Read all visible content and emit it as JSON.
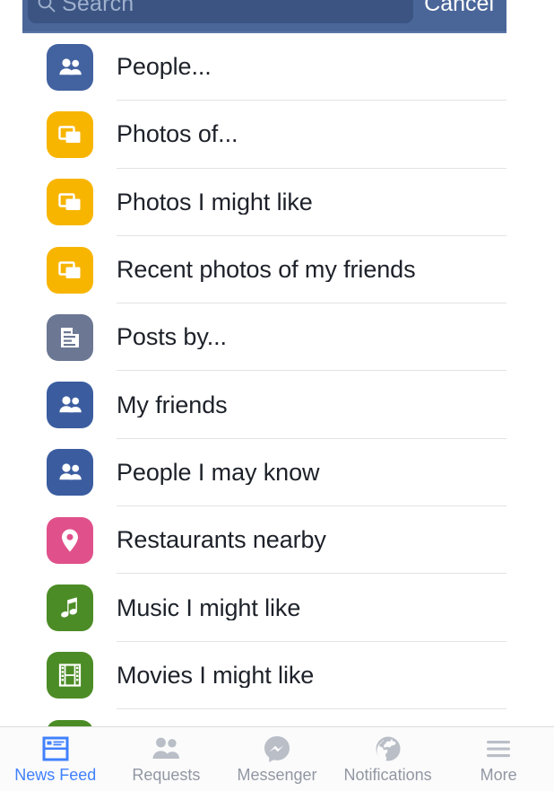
{
  "search": {
    "placeholder": "Search",
    "value": "",
    "icon": "search-icon",
    "cancel_label": "Cancel",
    "header_color": "#4a6699",
    "field_color": "#3b5482"
  },
  "results": {
    "items": [
      {
        "label": "People...",
        "icon": "people-icon",
        "color": "#4262a0"
      },
      {
        "label": "Photos of...",
        "icon": "photos-icon",
        "color": "#f7b500"
      },
      {
        "label": "Photos I might like",
        "icon": "photos-icon",
        "color": "#f7b500"
      },
      {
        "label": "Recent photos of my friends",
        "icon": "photos-icon",
        "color": "#f7b500"
      },
      {
        "label": "Posts by...",
        "icon": "post-icon",
        "color": "#6b7793"
      },
      {
        "label": "My friends",
        "icon": "people-icon",
        "color": "#3b5da0"
      },
      {
        "label": "People I may know",
        "icon": "people-icon",
        "color": "#3b5da0"
      },
      {
        "label": "Restaurants nearby",
        "icon": "location-pin-icon",
        "color": "#e0518b"
      },
      {
        "label": "Music I might like",
        "icon": "music-note-icon",
        "color": "#4c8c26"
      },
      {
        "label": "Movies I might like",
        "icon": "film-strip-icon",
        "color": "#4c8c26"
      },
      {
        "label": "",
        "icon": "film-strip-icon",
        "color": "#4c8c26"
      }
    ]
  },
  "tabbar": {
    "active_color": "#4080ff",
    "inactive_color": "#9197a3",
    "items": [
      {
        "label": "News Feed",
        "icon": "news-feed-icon",
        "active": true
      },
      {
        "label": "Requests",
        "icon": "friend-requests-icon",
        "active": false
      },
      {
        "label": "Messenger",
        "icon": "messenger-icon",
        "active": false
      },
      {
        "label": "Notifications",
        "icon": "globe-icon",
        "active": false
      },
      {
        "label": "More",
        "icon": "hamburger-icon",
        "active": false
      }
    ]
  }
}
